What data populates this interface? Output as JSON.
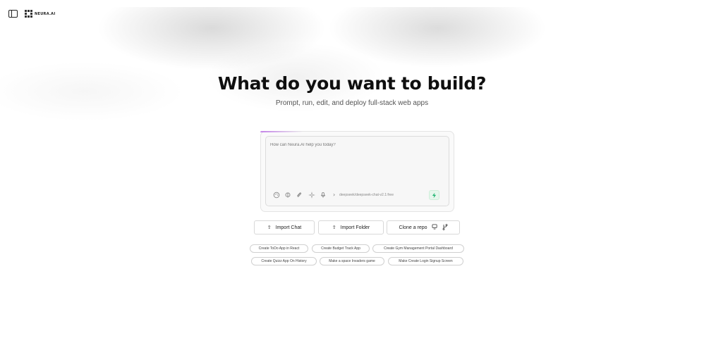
{
  "header": {
    "brand": "NEURA.AI",
    "icons": [
      "sidebar-toggle-icon",
      "logo-icon"
    ]
  },
  "hero": {
    "title": "What do you want to build?",
    "subtitle": "Prompt, run, edit, and deploy full-stack web apps"
  },
  "prompt": {
    "placeholder": "How can Neura.AI help you today?",
    "value": "",
    "tools": [
      "palette-icon",
      "brain-icon",
      "paperclip-icon",
      "sparkle-icon",
      "microphone-icon"
    ],
    "model": "deepseek/deepseek-chat-v2.1:free",
    "send_icon": "lightning-icon",
    "colors": {
      "send_bg": "#e6f7ec",
      "send_icon": "#22b573",
      "accent": "#be78e6"
    }
  },
  "actions": {
    "import_chat": "Import Chat",
    "import_folder": "Import Folder",
    "clone_repo": "Clone a repo"
  },
  "suggestions": [
    "Create ToDo App in React",
    "Create Budget Track App",
    "Create Gym Management Portal Dashboard",
    "Create Quizz App On History",
    "Make a space Invaders game",
    "Make Create Login Signup Screen"
  ]
}
